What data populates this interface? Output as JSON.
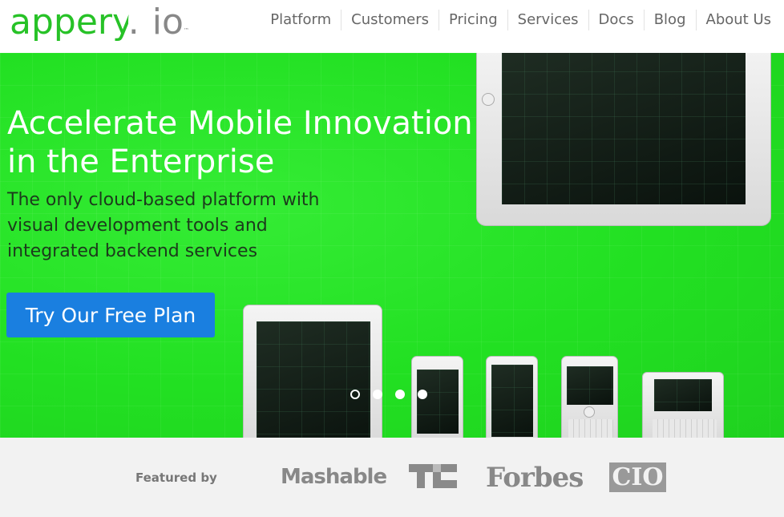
{
  "logo": {
    "name": "appery",
    "dot": ".",
    "suffix": "io",
    "tm": "™"
  },
  "nav": {
    "items": [
      "Platform",
      "Customers",
      "Pricing",
      "Services",
      "Docs",
      "Blog",
      "About Us"
    ]
  },
  "hero": {
    "headline": "Accelerate Mobile Innovation in the Enterprise",
    "subheadline": "The only cloud-based platform with visual development tools and integrated backend services",
    "cta_label": "Try Our Free Plan",
    "slides": {
      "count": 4,
      "active_index": 0
    }
  },
  "featured": {
    "label": "Featured by",
    "logos": {
      "mashable": "Mashable",
      "techcrunch": "TC",
      "forbes": "Forbes",
      "cio": "CIO"
    }
  },
  "colors": {
    "brand_green": "#27c227",
    "hero_green": "#22e022",
    "cta_blue": "#1a7fe0"
  }
}
